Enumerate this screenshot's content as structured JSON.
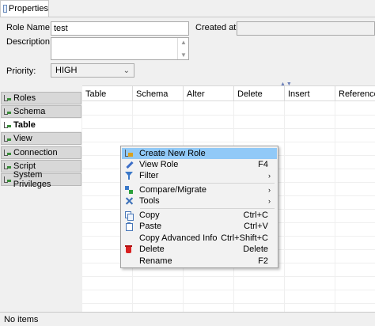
{
  "tab": {
    "label": "Properties"
  },
  "form": {
    "role_name_label": "Role Name:",
    "role_name_value": "test",
    "created_at_label": "Created at:",
    "created_at_value": "",
    "description_label": "Description:",
    "description_value": "",
    "priority_label": "Priority:",
    "priority_value": "HIGH"
  },
  "nav": {
    "items": [
      {
        "label": "Roles",
        "active": false
      },
      {
        "label": "Schema",
        "active": false
      },
      {
        "label": "Table",
        "active": true
      },
      {
        "label": "View",
        "active": false
      },
      {
        "label": "Connection",
        "active": false
      },
      {
        "label": "Script",
        "active": false
      },
      {
        "label": "System Privileges",
        "active": false
      }
    ]
  },
  "grid": {
    "columns": [
      "Table",
      "Schema",
      "Alter",
      "Delete",
      "Insert",
      "References"
    ],
    "rows": []
  },
  "context_menu": {
    "items": [
      {
        "label": "Create New Role",
        "shortcut": "",
        "submenu": false,
        "icon": "role-add-icon",
        "highlighted": true
      },
      {
        "label": "View Role",
        "shortcut": "F4",
        "submenu": false,
        "icon": "pencil-icon"
      },
      {
        "label": "Filter",
        "shortcut": "",
        "submenu": true,
        "icon": "funnel-icon"
      },
      {
        "label": "Compare/Migrate",
        "shortcut": "",
        "submenu": true,
        "icon": "compare-icon"
      },
      {
        "label": "Tools",
        "shortcut": "",
        "submenu": true,
        "icon": "tools-icon"
      },
      {
        "label": "Copy",
        "shortcut": "Ctrl+C",
        "submenu": false,
        "icon": "copy-icon"
      },
      {
        "label": "Paste",
        "shortcut": "Ctrl+V",
        "submenu": false,
        "icon": "paste-icon"
      },
      {
        "label": "Copy Advanced Info",
        "shortcut": "Ctrl+Shift+C",
        "submenu": false,
        "icon": ""
      },
      {
        "label": "Delete",
        "shortcut": "Delete",
        "submenu": false,
        "icon": "delete-icon"
      },
      {
        "label": "Rename",
        "shortcut": "F2",
        "submenu": false,
        "icon": ""
      }
    ],
    "submenu_glyph": "›"
  },
  "status_bar": {
    "text": "No items"
  },
  "colors": {
    "menu_highlight": "#91c9f7",
    "selection_accent": "#3a78c8"
  }
}
